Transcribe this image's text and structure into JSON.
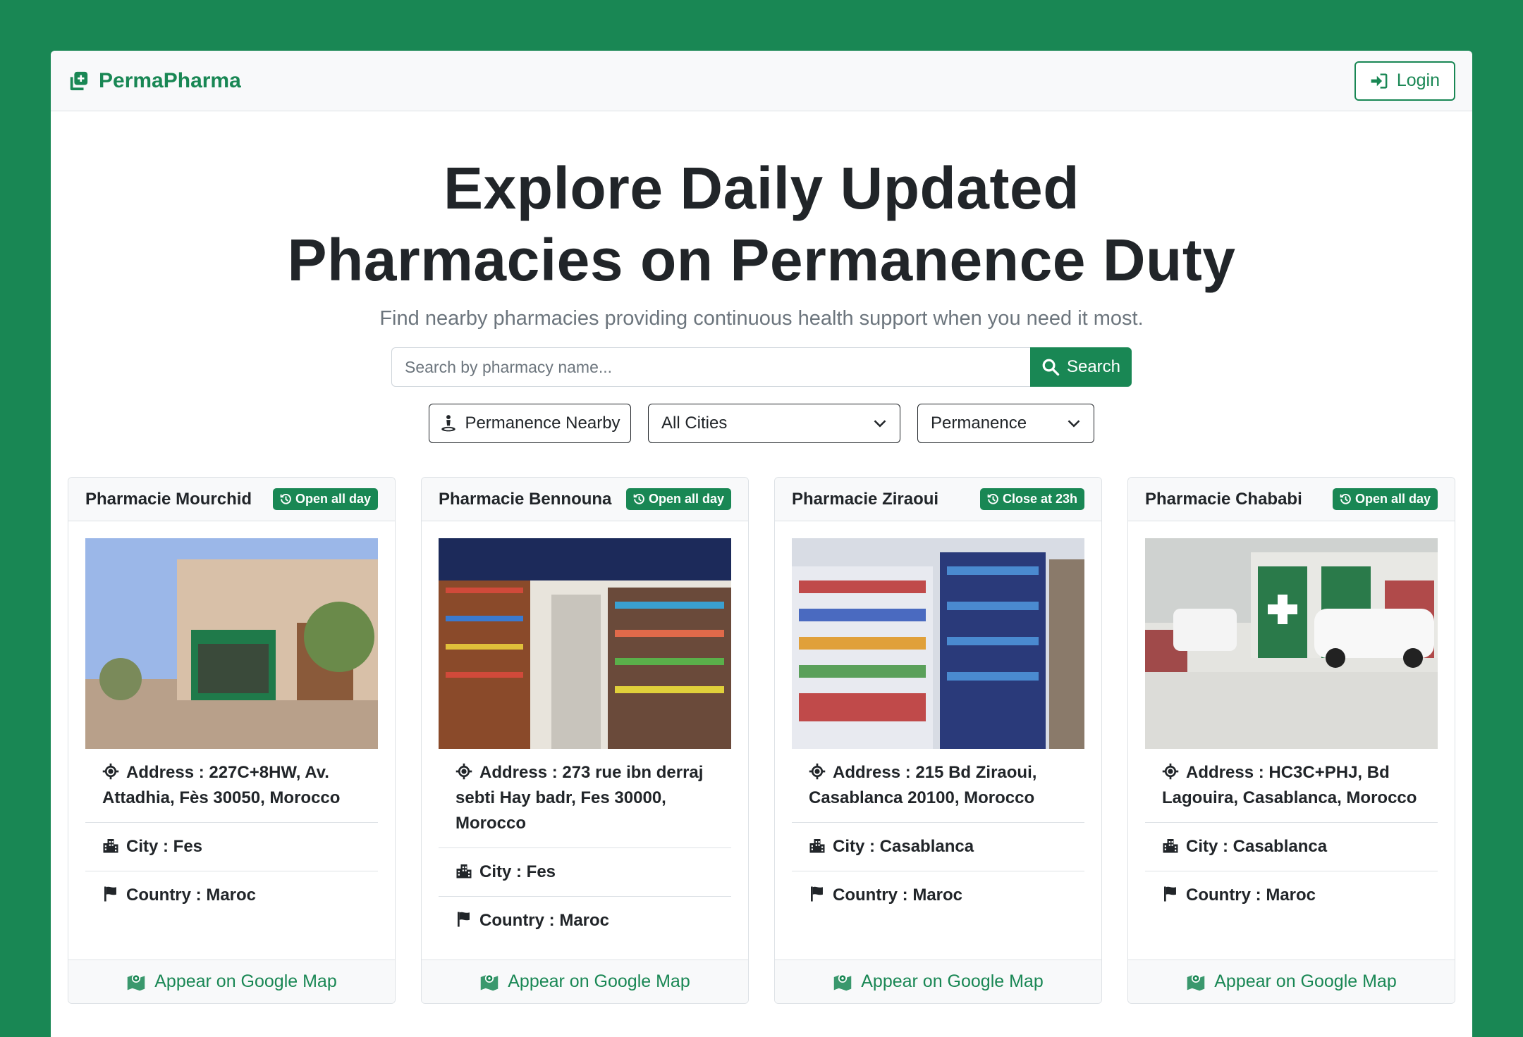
{
  "brand": {
    "name": "PermaPharma",
    "color": "#198754"
  },
  "nav": {
    "login_label": "Login"
  },
  "hero": {
    "title_line1": "Explore Daily Updated",
    "title_line2": "Pharmacies on Permanence Duty",
    "subtitle": "Find nearby pharmacies providing continuous health support when you need it most."
  },
  "search": {
    "placeholder": "Search by pharmacy name...",
    "button_label": "Search"
  },
  "filters": {
    "nearby_label": "Permanence Nearby",
    "city_selected": "All Cities",
    "type_selected": "Permanence"
  },
  "cards": [
    {
      "name": "Pharmacie Mourchid",
      "badge": "Open all day",
      "address": "Address : 227C+8HW, Av. Attadhia, Fès 30050, Morocco",
      "city": "City : Fes",
      "country": "Country : Maroc",
      "map_label": "Appear on Google Map"
    },
    {
      "name": "Pharmacie Bennouna",
      "badge": "Open all day",
      "address": "Address : 273 rue ibn derraj sebti Hay badr, Fes 30000, Morocco",
      "city": "City : Fes",
      "country": "Country : Maroc",
      "map_label": "Appear on Google Map"
    },
    {
      "name": "Pharmacie Ziraoui",
      "badge": "Close at 23h",
      "address": "Address : 215 Bd Ziraoui, Casablanca 20100, Morocco",
      "city": "City : Casablanca",
      "country": "Country : Maroc",
      "map_label": "Appear on Google Map"
    },
    {
      "name": "Pharmacie Chababi",
      "badge": "Open all day",
      "address": "Address : HC3C+PHJ, Bd Lagouira, Casablanca, Morocco",
      "city": "City : Casablanca",
      "country": "Country : Maroc",
      "map_label": "Appear on Google Map"
    }
  ]
}
